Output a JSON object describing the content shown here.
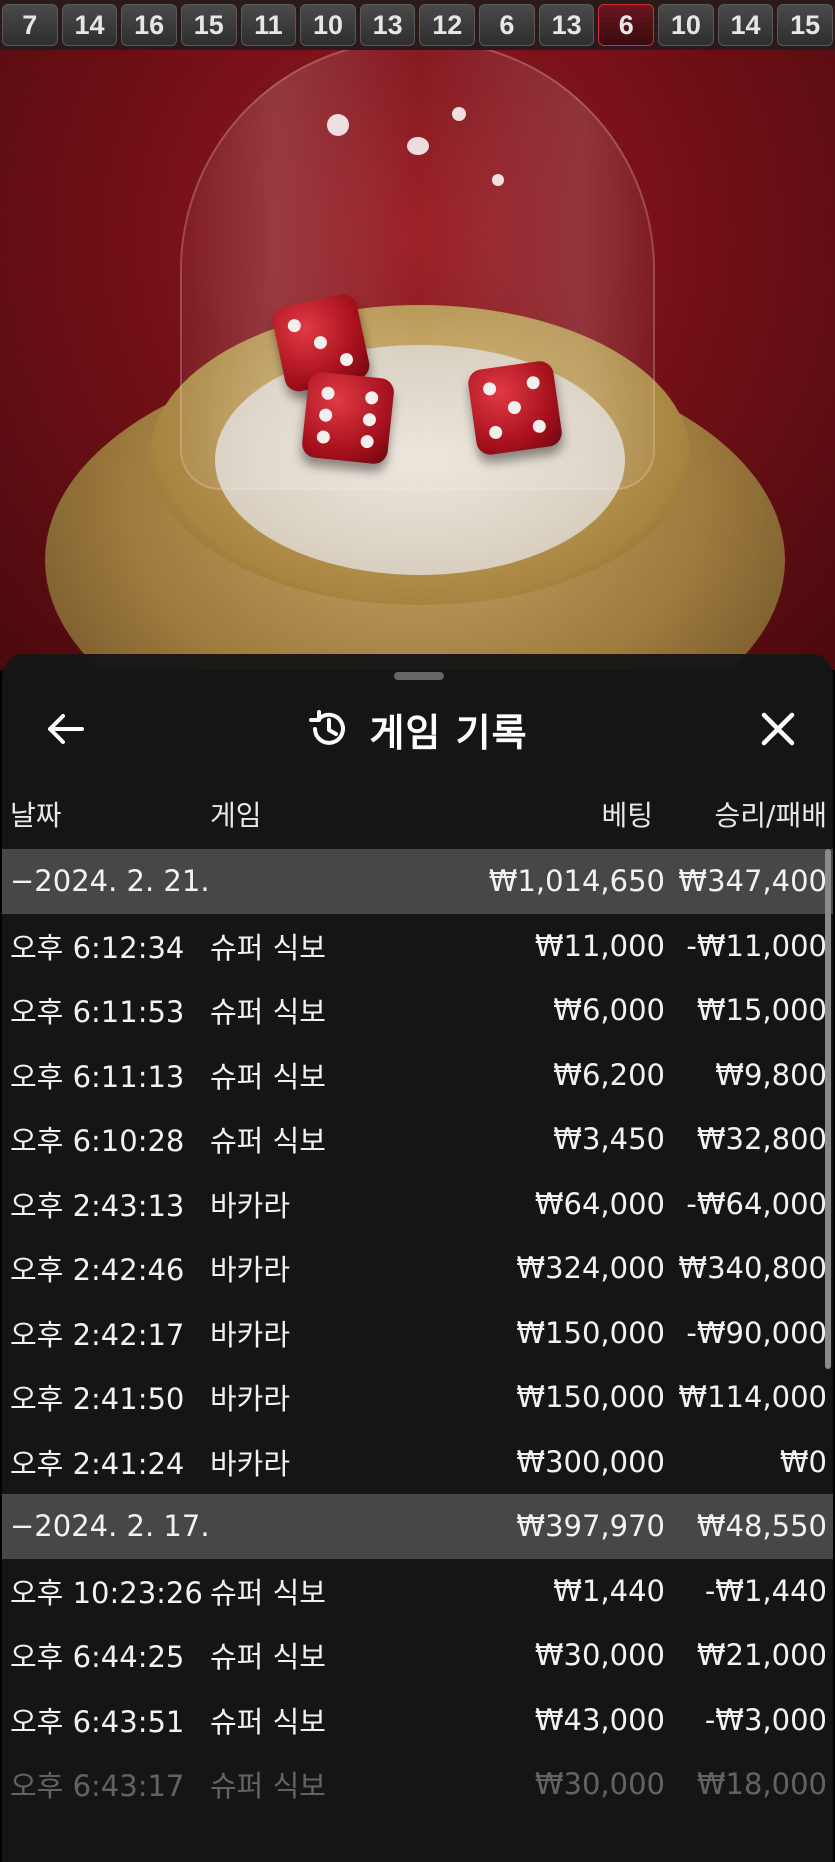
{
  "history": {
    "numbers": [
      "7",
      "14",
      "16",
      "15",
      "11",
      "10",
      "13",
      "12",
      "6",
      "13",
      "6",
      "10",
      "14",
      "15"
    ],
    "highlight_index": 10
  },
  "sheet": {
    "title": "게임 기록",
    "columns": {
      "date": "날짜",
      "game": "게임",
      "bet": "베팅",
      "result": "승리/패배"
    },
    "rows": [
      {
        "type": "group",
        "time": "−2024. 2. 21.",
        "game": "",
        "bet": "₩1,014,650",
        "result": "₩347,400"
      },
      {
        "type": "item",
        "time": "오후 6:12:34",
        "game": "슈퍼 식보",
        "bet": "₩11,000",
        "result": "-₩11,000"
      },
      {
        "type": "item",
        "time": "오후 6:11:53",
        "game": "슈퍼 식보",
        "bet": "₩6,000",
        "result": "₩15,000"
      },
      {
        "type": "item",
        "time": "오후 6:11:13",
        "game": "슈퍼 식보",
        "bet": "₩6,200",
        "result": "₩9,800"
      },
      {
        "type": "item",
        "time": "오후 6:10:28",
        "game": "슈퍼 식보",
        "bet": "₩3,450",
        "result": "₩32,800"
      },
      {
        "type": "item",
        "time": "오후 2:43:13",
        "game": "바카라",
        "bet": "₩64,000",
        "result": "-₩64,000"
      },
      {
        "type": "item",
        "time": "오후 2:42:46",
        "game": "바카라",
        "bet": "₩324,000",
        "result": "₩340,800"
      },
      {
        "type": "item",
        "time": "오후 2:42:17",
        "game": "바카라",
        "bet": "₩150,000",
        "result": "-₩90,000"
      },
      {
        "type": "item",
        "time": "오후 2:41:50",
        "game": "바카라",
        "bet": "₩150,000",
        "result": "₩114,000"
      },
      {
        "type": "item",
        "time": "오후 2:41:24",
        "game": "바카라",
        "bet": "₩300,000",
        "result": "₩0"
      },
      {
        "type": "group",
        "time": "−2024. 2. 17.",
        "game": "",
        "bet": "₩397,970",
        "result": "₩48,550"
      },
      {
        "type": "item",
        "time": "오후 10:23:26",
        "game": "슈퍼 식보",
        "bet": "₩1,440",
        "result": "-₩1,440"
      },
      {
        "type": "item",
        "time": "오후 6:44:25",
        "game": "슈퍼 식보",
        "bet": "₩30,000",
        "result": "₩21,000"
      },
      {
        "type": "item",
        "time": "오후 6:43:51",
        "game": "슈퍼 식보",
        "bet": "₩43,000",
        "result": "-₩3,000"
      },
      {
        "type": "faded",
        "time": "오후 6:43:17",
        "game": "슈퍼 식보",
        "bet": "₩30,000",
        "result": "₩18,000"
      }
    ]
  },
  "icons": {
    "back": "arrow-left-icon",
    "history": "history-clock-icon",
    "close": "close-icon"
  }
}
